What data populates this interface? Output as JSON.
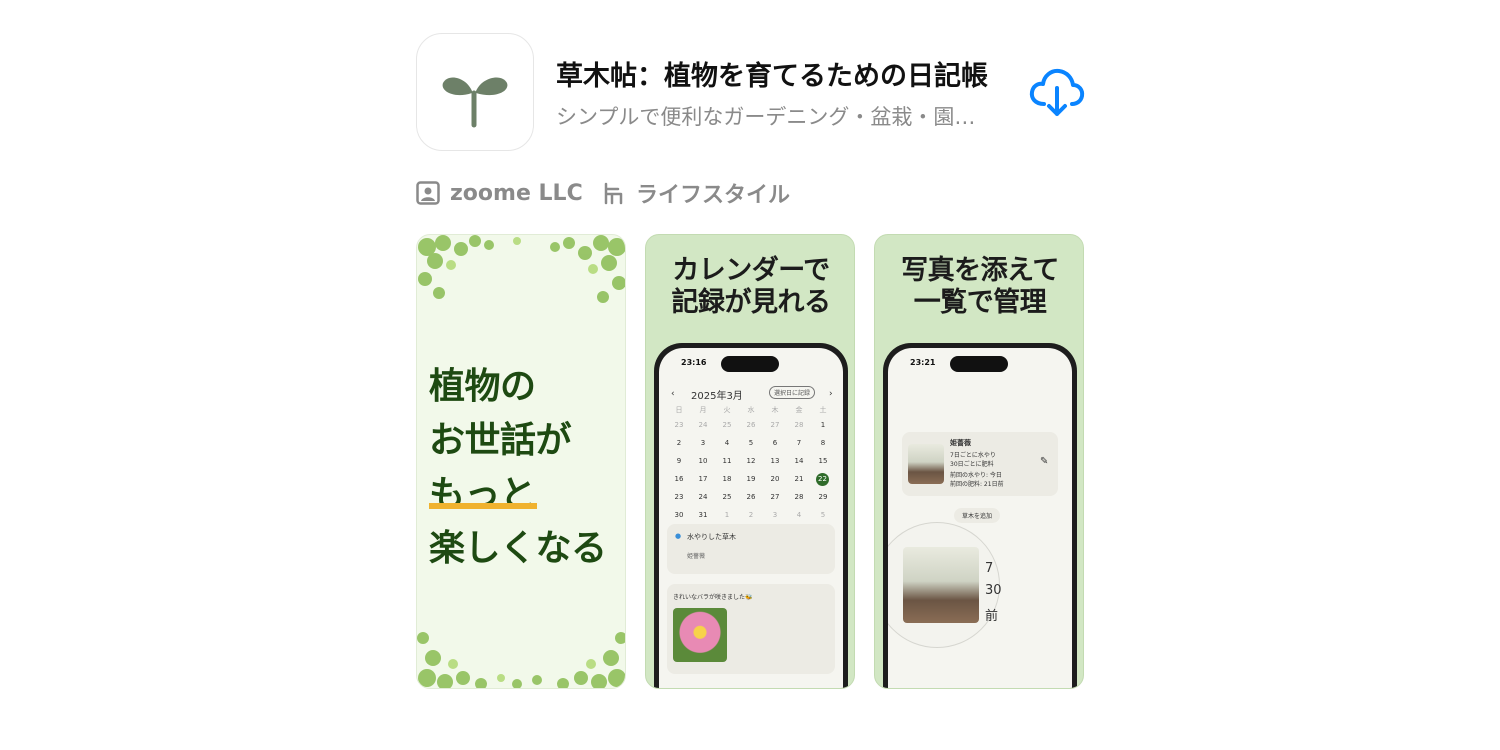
{
  "app": {
    "title": "草木帖：植物を育てるための日記帳",
    "subtitle": "シンプルで便利なガーデニング・盆栽・園…",
    "icon": "sprout-icon",
    "developer": "zoome LLC",
    "category": "ライフスタイル",
    "accent_color": "#0a84ff"
  },
  "screenshots": [
    {
      "lines": [
        "植物の",
        "お世話が",
        "もっと",
        "楽しくなる"
      ]
    },
    {
      "headline": [
        "カレンダーで",
        "記録が見れる"
      ],
      "time": "23:16",
      "month": "2025年3月",
      "record_button": "選択日に記録",
      "weekdays": [
        "日",
        "月",
        "火",
        "水",
        "木",
        "金",
        "土"
      ],
      "weeks": [
        [
          "23",
          "24",
          "25",
          "26",
          "27",
          "28",
          "1"
        ],
        [
          "2",
          "3",
          "4",
          "5",
          "6",
          "7",
          "8"
        ],
        [
          "9",
          "10",
          "11",
          "12",
          "13",
          "14",
          "15"
        ],
        [
          "16",
          "17",
          "18",
          "19",
          "20",
          "21",
          "22"
        ],
        [
          "23",
          "24",
          "25",
          "26",
          "27",
          "28",
          "29"
        ],
        [
          "30",
          "31",
          "1",
          "2",
          "3",
          "4",
          "5"
        ]
      ],
      "watered_label": "水やりした草木",
      "watered_plant": "姫薔薇",
      "note": "きれいなバラが咲きました🐝"
    },
    {
      "headline": [
        "写真を添えて",
        "一覧で管理"
      ],
      "time": "23:21",
      "plant_name": "姫薔薇",
      "plant_detail_1": "7日ごとに水やり",
      "plant_detail_2": "30日ごとに肥料",
      "plant_detail_3": "前回の水やり: 今日",
      "plant_detail_4": "前回の肥料: 21日前",
      "add_button": "草木を追加",
      "zoom_text_1": "7",
      "zoom_text_2": "30",
      "zoom_text_3": "前"
    }
  ]
}
